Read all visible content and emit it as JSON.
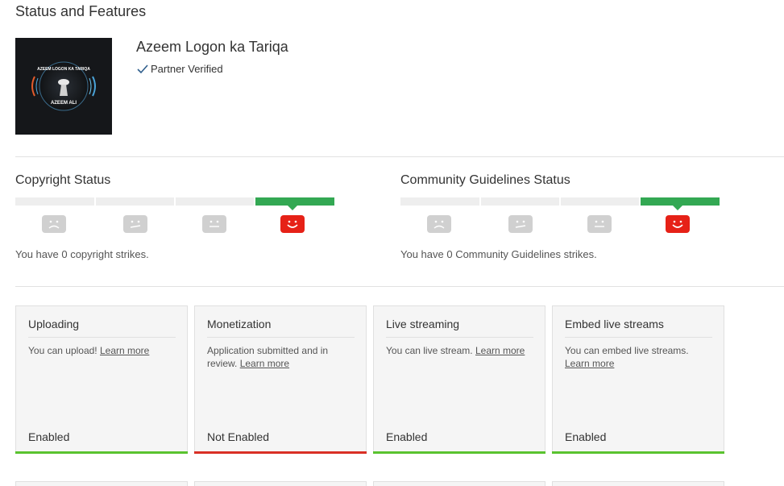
{
  "page_title": "Status and Features",
  "channel": {
    "name": "Azeem Logon ka Tariqa",
    "verified_label": "Partner Verified",
    "avatar_text_top": "AZEEM LOGON KA TARIQA",
    "avatar_text_bottom": "AZEEM ALI"
  },
  "copyright": {
    "title": "Copyright Status",
    "message": "You have 0 copyright strikes.",
    "active_level": 4
  },
  "community": {
    "title": "Community Guidelines Status",
    "message": "You have 0 Community Guidelines strikes.",
    "active_level": 4
  },
  "colors": {
    "enabled": "#5ac32f",
    "not_enabled": "#d93025",
    "meter_active": "#33a853",
    "face_active": "#e62117"
  },
  "features": [
    {
      "title": "Uploading",
      "desc": "You can upload!",
      "link": "Learn more",
      "state": "Enabled",
      "enabled": true
    },
    {
      "title": "Monetization",
      "desc": "Application submitted and in review.",
      "link": "Learn more",
      "state": "Not Enabled",
      "enabled": false
    },
    {
      "title": "Live streaming",
      "desc": "You can live stream.",
      "link": "Learn more",
      "state": "Enabled",
      "enabled": true
    },
    {
      "title": "Embed live streams",
      "desc": "You can embed live streams.",
      "link": "Learn more",
      "state": "Enabled",
      "enabled": true
    }
  ]
}
